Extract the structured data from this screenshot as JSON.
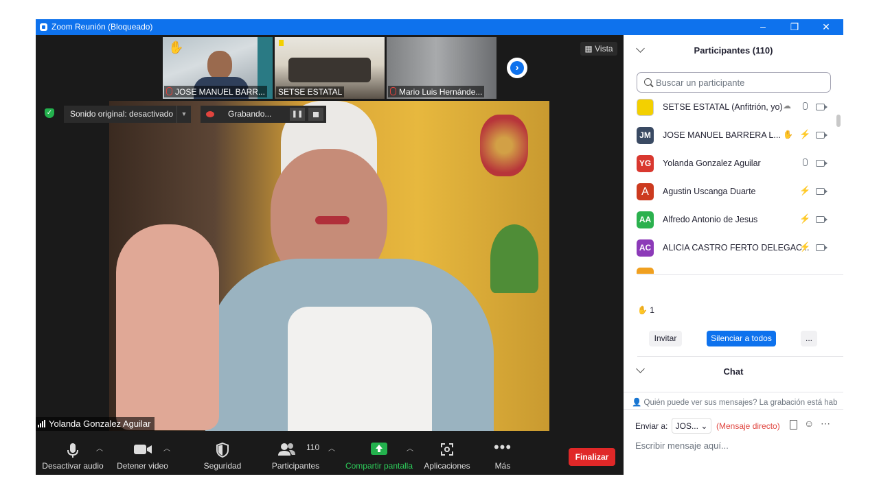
{
  "window": {
    "title": "Zoom Reunión (Bloqueado)",
    "controls": [
      "–",
      "❐",
      "✕"
    ]
  },
  "thumbnails": [
    {
      "name": "JOSE MANUEL BARR...",
      "muted": true,
      "hand_raised": true
    },
    {
      "name": "SETSE ESTATAL",
      "muted": false,
      "hand_raised": false
    },
    {
      "name": "Mario Luis Hernánde...",
      "muted": true,
      "hand_raised": false
    }
  ],
  "next_icon": "chevron-right-icon",
  "view_button": {
    "label": "Vista",
    "icon": "grid-icon"
  },
  "audio_status": {
    "label": "Sonido original: desactivado"
  },
  "recording": {
    "label": "Grabando..."
  },
  "active_speaker": "Yolanda Gonzalez Aguilar",
  "toolbar": {
    "mute_label": "Desactivar audio",
    "video_label": "Detener video",
    "security_label": "Seguridad",
    "participants_label": "Participantes",
    "participants_count": "110",
    "share_label": "Compartir pantalla",
    "apps_label": "Aplicaciones",
    "more_label": "Más",
    "end_label": "Finalizar"
  },
  "panel": {
    "participants_title": "Participantes (110)",
    "search_placeholder": "Buscar un participante",
    "participants": [
      {
        "initials": "",
        "name": "SETSE ESTATAL (Anfitrión, yo)",
        "color": "#f3d000",
        "mic": "on",
        "hand": false
      },
      {
        "initials": "JM",
        "name": "JOSE MANUEL BARRERA L...",
        "color": "#3a4a63",
        "mic": "muted",
        "hand": true
      },
      {
        "initials": "YG",
        "name": "Yolanda Gonzalez Aguilar",
        "color": "#d9382f",
        "mic": "on",
        "hand": false
      },
      {
        "initials": "A",
        "name": "Agustin Uscanga Duarte",
        "color": "#cc3a1f",
        "mic": "muted",
        "hand": false
      },
      {
        "initials": "AA",
        "name": "Alfredo Antonio de Jesus",
        "color": "#2bb14e",
        "mic": "muted",
        "hand": false
      },
      {
        "initials": "AC",
        "name": "ALICIA CASTRO FERTO DELEGAC...",
        "color": "#8c3ab8",
        "mic": "muted",
        "hand": false
      }
    ],
    "raised_hands_count": "1",
    "invite_label": "Invitar",
    "mute_all_label": "Silenciar a todos",
    "more_label": "...",
    "chat_title": "Chat",
    "chat_info": "Quién puede ver sus mensajes? La grabación está habilit",
    "send_to_label": "Enviar a:",
    "send_to_value": "JOS...",
    "direct_label": "(Mensaje directo)",
    "message_placeholder": "Escribir mensaje aquí..."
  }
}
